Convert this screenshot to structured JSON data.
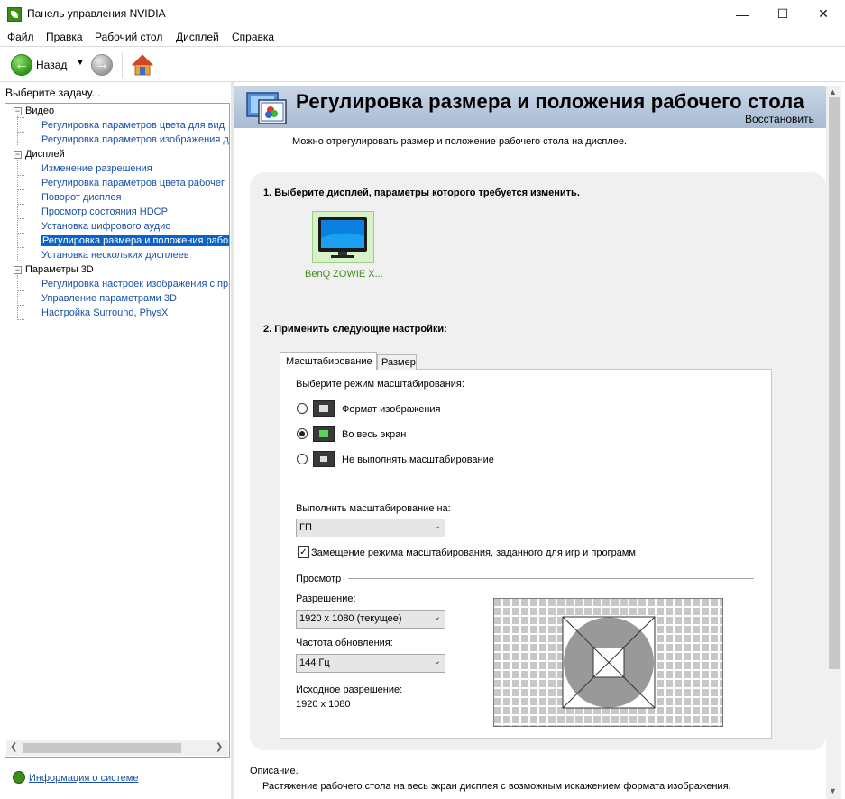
{
  "window": {
    "title": "Панель управления NVIDIA",
    "minimize": "—",
    "maximize": "☐",
    "close": "✕"
  },
  "menu": [
    "Файл",
    "Правка",
    "Рабочий стол",
    "Дисплей",
    "Справка"
  ],
  "toolbar": {
    "back_label": "Назад",
    "back_icon": "back-arrow-icon",
    "forward_icon": "forward-arrow-icon",
    "home_icon": "home-icon"
  },
  "sidebar": {
    "header": "Выберите задачу...",
    "categories": [
      {
        "label": "Видео",
        "items": [
          "Регулировка параметров цвета для вид",
          "Регулировка параметров изображения д"
        ]
      },
      {
        "label": "Дисплей",
        "items": [
          "Изменение разрешения",
          "Регулировка параметров цвета рабочег",
          "Поворот дисплея",
          "Просмотр состояния HDCP",
          "Установка цифрового аудио",
          "Регулировка размера и положения рабо",
          "Установка нескольких дисплеев"
        ]
      },
      {
        "label": "Параметры 3D",
        "items": [
          "Регулировка настроек изображения с пр",
          "Управление параметрами 3D",
          "Настройка Surround, PhysX"
        ]
      }
    ],
    "selected": "Регулировка размера и положения рабо",
    "system_info_link": "Информация о системе"
  },
  "page": {
    "title": "Регулировка размера и положения рабочего стола",
    "restore_link": "Восстановить",
    "description": "Можно отрегулировать размер и положение рабочего стола на дисплее.",
    "step1": "1. Выберите дисплей, параметры которого требуется изменить.",
    "display_name": "BenQ ZOWIE X...",
    "step2": "2. Применить следующие настройки:",
    "tabs": [
      "Масштабирование",
      "Размер"
    ],
    "active_tab": "Масштабирование",
    "scaling": {
      "mode_label": "Выберите режим масштабирования:",
      "options": [
        "Формат изображения",
        "Во весь экран",
        "Не выполнять масштабирование"
      ],
      "selected_option": "Во весь экран",
      "perform_on_label": "Выполнить масштабирование на:",
      "perform_on_value": "ГП",
      "override_checkbox": "Замещение режима масштабирования, заданного для игр и программ",
      "override_checked": true
    },
    "preview": {
      "section_label": "Просмотр",
      "resolution_label": "Разрешение:",
      "resolution_value": "1920 x 1080 (текущее)",
      "refresh_label": "Частота обновления:",
      "refresh_value": "144 Гц",
      "native_label": "Исходное разрешение:",
      "native_value": "1920 x 1080"
    },
    "bottom_description_heading": "Описание.",
    "bottom_description_text": "Растяжение рабочего стола на весь экран дисплея с возможным искажением формата изображения."
  },
  "colors": {
    "nvidia_green": "#3d8b1a",
    "link_blue": "#1a4fa8",
    "selection_blue": "#0a64c8",
    "banner": "#b5c6db"
  }
}
